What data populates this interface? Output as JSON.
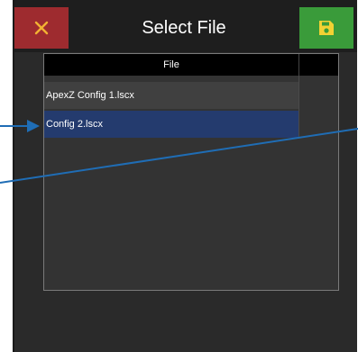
{
  "header": {
    "title": "Select File",
    "close_icon": "close-icon",
    "save_icon": "floppy-disk-icon"
  },
  "table": {
    "column_header": "File",
    "rows": [
      {
        "name": "ApexZ Config 1.lscx",
        "selected": false
      },
      {
        "name": "Config 2.lscx",
        "selected": true
      }
    ]
  },
  "colors": {
    "close_button": "#9e2b2f",
    "save_button": "#3a9b3a",
    "selected_row": "#243b6e",
    "callout_line": "#1f6db5"
  }
}
